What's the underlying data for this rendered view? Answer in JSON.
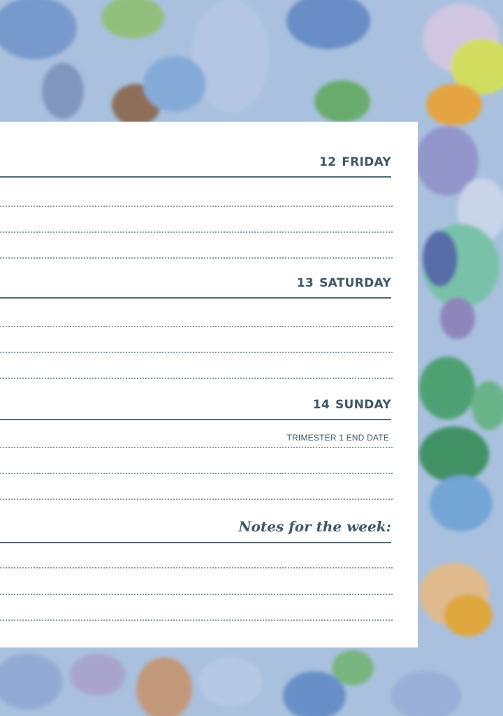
{
  "days": [
    {
      "number": "12",
      "name": "FRIDAY",
      "note": ""
    },
    {
      "number": "13",
      "name": "SATURDAY",
      "note": ""
    },
    {
      "number": "14",
      "name": "SUNDAY",
      "note": "TRIMESTER 1 END DATE"
    }
  ],
  "notes": {
    "title": "Notes for the week:"
  },
  "colors": {
    "background": "#a9c1de",
    "heading": "#3f5866",
    "rule": "#536a74",
    "dotted_rule": "#8a9ba5"
  }
}
